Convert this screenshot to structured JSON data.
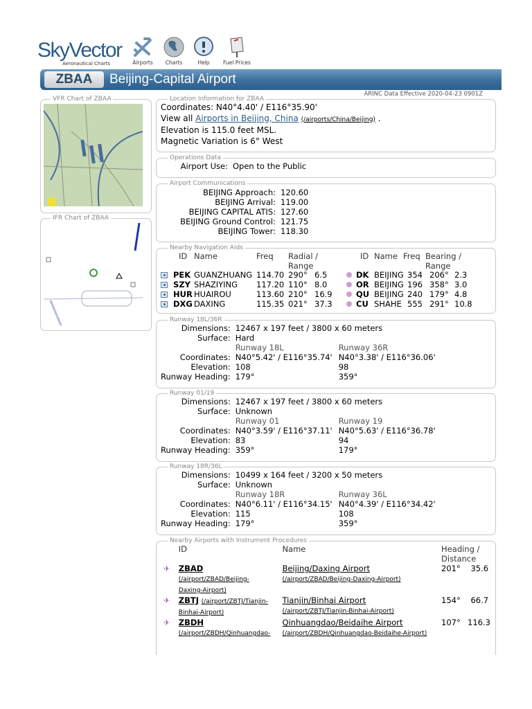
{
  "header": {
    "logo": "SkyVector",
    "logo_sub": "Aeronautical Charts",
    "nav": [
      {
        "label": "Airports",
        "icon": "airplane-icon"
      },
      {
        "label": "Charts",
        "icon": "globe-icon"
      },
      {
        "label": "Help",
        "icon": "help-icon"
      },
      {
        "label": "Fuel Prices",
        "icon": "fuel-sign-icon"
      }
    ]
  },
  "banner": {
    "id": "ZBAA",
    "title": "Beijing-Capital Airport"
  },
  "arinc": "ARINC Data Effective 2020-04-23 0901Z",
  "vfr": {
    "legend": "VFR Chart of ZBAA"
  },
  "ifr": {
    "legend": "IFR Chart of ZBAA"
  },
  "location": {
    "legend": "Location Information for ZBAA",
    "coordinates": "Coordinates: N40°4.40' / E116°35.90'",
    "view_all_prefix": "View all ",
    "view_all_link": "Airports in Beijing, China",
    "view_all_path": "(/airports/China/Beijing)",
    "view_all_suffix": " .",
    "elevation": "Elevation is 115.0 feet MSL.",
    "magvar": "Magnetic Variation is 6° West"
  },
  "operations": {
    "legend": "Operations Data",
    "label": "Airport Use:",
    "value": "Open to the Public"
  },
  "comms": {
    "legend": "Airport Communications",
    "rows": [
      {
        "label": "BEIJING Approach:",
        "value": "120.60"
      },
      {
        "label": "BEIJING Arrival:",
        "value": "119.00"
      },
      {
        "label": "BEIJING CAPITAL ATIS:",
        "value": "127.60"
      },
      {
        "label": "BEIJING Ground Control:",
        "value": "121.75"
      },
      {
        "label": "BEIJING Tower:",
        "value": "118.30"
      }
    ]
  },
  "navaids": {
    "legend": "Nearby Navigation Aids",
    "vor_headers": {
      "id": "ID",
      "name": "Name",
      "freq": "Freq",
      "radial": "Radial /",
      "range": "Range"
    },
    "ndb_headers": {
      "id": "ID",
      "name": "Name",
      "freq": "Freq",
      "bearing": "Bearing /",
      "range": "Range"
    },
    "vor": [
      {
        "id": "PEK",
        "name": "GUANZHUANG",
        "freq": "114.70",
        "radial": "290°",
        "range": "6.5"
      },
      {
        "id": "SZY",
        "name": "SHAZIYING",
        "freq": "117.20",
        "radial": "110°",
        "range": "8.0"
      },
      {
        "id": "HUR",
        "name": "HUAIROU",
        "freq": "113.60",
        "radial": "210°",
        "range": "16.9"
      },
      {
        "id": "DXG",
        "name": "DAXING",
        "freq": "115.35",
        "radial": "021°",
        "range": "37.3"
      }
    ],
    "ndb": [
      {
        "id": "DK",
        "name": "BEIJING",
        "freq": "354",
        "bearing": "206°",
        "range": "2.3"
      },
      {
        "id": "OR",
        "name": "BEIJING",
        "freq": "196",
        "bearing": "358°",
        "range": "3.0"
      },
      {
        "id": "QU",
        "name": "BEIJING",
        "freq": "240",
        "bearing": "179°",
        "range": "4.8"
      },
      {
        "id": "CU",
        "name": "SHAHE",
        "freq": "555",
        "bearing": "291°",
        "range": "10.8"
      }
    ]
  },
  "labels": {
    "dimensions": "Dimensions:",
    "surface": "Surface:",
    "coordinates": "Coordinates:",
    "elevation": "Elevation:",
    "heading": "Runway Heading:"
  },
  "runways": [
    {
      "legend": "Runway 18L/36R",
      "dimensions": "12467 x 197 feet / 3800 x 60 meters",
      "surface": "Hard",
      "ends": [
        {
          "name": "Runway 18L",
          "coords": "N40°5.42' / E116°35.74'",
          "elev": "108",
          "heading": "179°"
        },
        {
          "name": "Runway 36R",
          "coords": "N40°3.38' / E116°36.06'",
          "elev": "98",
          "heading": "359°"
        }
      ]
    },
    {
      "legend": "Runway 01/19",
      "dimensions": "12467 x 197 feet / 3800 x 60 meters",
      "surface": "Unknown",
      "ends": [
        {
          "name": "Runway 01",
          "coords": "N40°3.59' / E116°37.11'",
          "elev": "83",
          "heading": "359°"
        },
        {
          "name": "Runway 19",
          "coords": "N40°5.63' / E116°36.78'",
          "elev": "94",
          "heading": "179°"
        }
      ]
    },
    {
      "legend": "Runway 18R/36L",
      "dimensions": "10499 x 164 feet / 3200 x 50 meters",
      "surface": "Unknown",
      "ends": [
        {
          "name": "Runway 18R",
          "coords": "N40°6.11' / E116°34.15'",
          "elev": "115",
          "heading": "179°"
        },
        {
          "name": "Runway 36L",
          "coords": "N40°4.39' / E116°34.42'",
          "elev": "108",
          "heading": "359°"
        }
      ]
    }
  ],
  "nearby": {
    "legend": "Nearby Airports with Instrument Procedures",
    "headers": {
      "id": "ID",
      "name": "Name",
      "hd1": "Heading /",
      "hd2": "Distance"
    },
    "rows": [
      {
        "id": "ZBAD",
        "id_path1": "(/airport/ZBAD/Beijing-",
        "id_path2": "Daxing-Airport)",
        "name": "Beijing/Daxing Airport",
        "name_path": "(/airport/ZBAD/Beijing-Daxing-Airport)",
        "heading": "201°",
        "dist": "35.6"
      },
      {
        "id": "ZBTJ",
        "id_path1": "(/airport/ZBTJ/Tianjin-",
        "id_path2": "Binhai-Airport)",
        "name": "Tianjin/Binhai Airport",
        "name_path": "(/airport/ZBTJ/Tianjin-Binhai-Airport)",
        "heading": "154°",
        "dist": "66.7"
      },
      {
        "id": "ZBDH",
        "id_path1": "(/airport/ZBDH/Qinhuangdao-",
        "id_path2": "",
        "name": "Qinhuangdao/Beidaihe Airport",
        "name_path": "(/airport/ZBDH/Qinhuangdao-Beidaihe-Airport)",
        "heading": "107°",
        "dist": "116.3"
      }
    ]
  }
}
